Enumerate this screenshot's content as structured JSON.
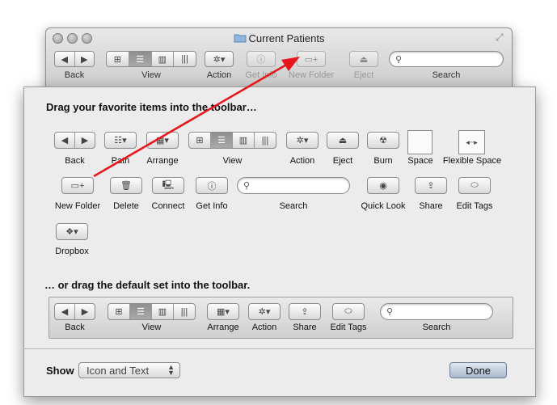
{
  "window": {
    "title": "Current Patients",
    "toolbar": {
      "back": "Back",
      "view": "View",
      "action": "Action",
      "get_info": "Get Info",
      "new_folder": "New Folder",
      "eject": "Eject",
      "search": "Search"
    }
  },
  "sheet": {
    "heading": "Drag your favorite items into the toolbar…",
    "items": {
      "back": "Back",
      "path": "Path",
      "arrange": "Arrange",
      "view": "View",
      "action": "Action",
      "eject": "Eject",
      "burn": "Burn",
      "space": "Space",
      "flexible_space": "Flexible Space",
      "new_folder": "New Folder",
      "delete": "Delete",
      "connect": "Connect",
      "get_info": "Get Info",
      "search": "Search",
      "quick_look": "Quick Look",
      "share": "Share",
      "edit_tags": "Edit Tags",
      "dropbox": "Dropbox"
    },
    "default_heading": "… or drag the default set into the toolbar.",
    "default_set": {
      "back": "Back",
      "view": "View",
      "arrange": "Arrange",
      "action": "Action",
      "share": "Share",
      "edit_tags": "Edit Tags",
      "search": "Search"
    },
    "show_label": "Show",
    "show_value": "Icon and Text",
    "done_label": "Done"
  },
  "colors": {
    "annotation_arrow": "#e8151b",
    "done_button": "#b9c7d8"
  }
}
